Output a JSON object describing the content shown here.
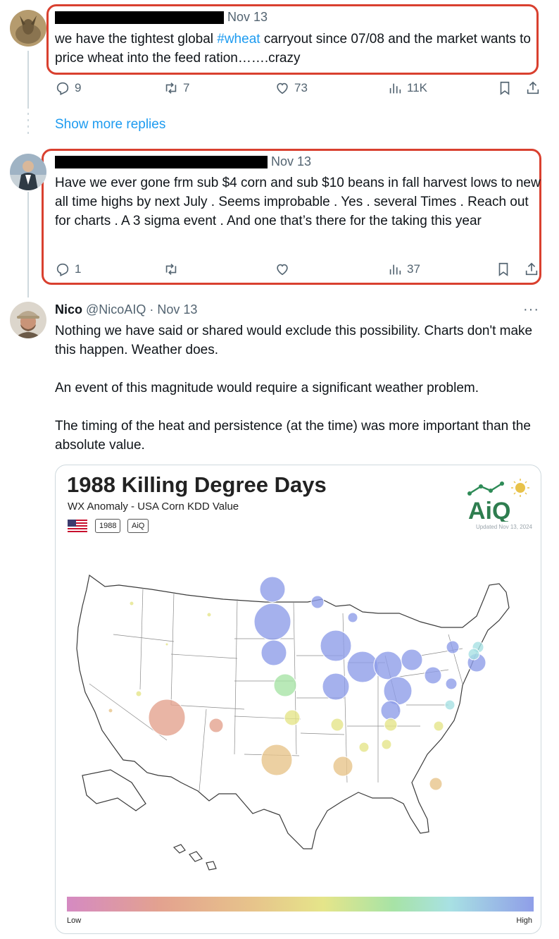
{
  "tweets": [
    {
      "name": "",
      "handle": "",
      "date": "Nov 13",
      "text": "we have the tightest global #wheat carryout since 07/08 and the market wants to price wheat into the feed ration…….crazy",
      "text_before": "we have the tightest global ",
      "hashtag": "#wheat",
      "text_after": " carryout since 07/08 and the market wants to price wheat into the feed ration…….crazy",
      "replies": "9",
      "retweets": "7",
      "likes": "73",
      "views": "11K"
    },
    {
      "name": "",
      "handle": "",
      "date": "Nov 13",
      "text": "Have we ever gone frm sub $4 corn and sub $10 beans in fall harvest lows to new all time highs by next July . Seems improbable . Yes . several Times . Reach out for charts . A 3 sigma event . And one that’s there for the taking  this year",
      "replies": "1",
      "retweets": "",
      "likes": "",
      "views": "37"
    },
    {
      "name": "Nico",
      "handle": "@NicoAIQ",
      "separator": "·",
      "date": "Nov 13",
      "paragraphs": [
        "Nothing we have said or shared would exclude this possibility. Charts don't make this happen. Weather does.",
        "An event of this magnitude would require a significant weather problem.",
        "The timing of the heat and persistence (at the time) was more important than the absolute value."
      ]
    }
  ],
  "show_more_replies": "Show more replies",
  "more_icon": "···",
  "card": {
    "title": "1988 Killing Degree Days",
    "subtitle": "WX Anomaly - USA Corn KDD Value",
    "tags": [
      "1988",
      "AiQ"
    ],
    "logo_text": "AiQ",
    "updated": "Updated Nov 13, 2024",
    "legend_low": "Low",
    "legend_high": "High",
    "colors": [
      "#d58ac2",
      "#e3a28f",
      "#e7c48b",
      "#e5e58a",
      "#a7e3a6",
      "#a8e1e3",
      "#8f9ee8"
    ]
  },
  "colors": {
    "link": "#1d9bf0",
    "highlight_box": "#d9402f",
    "muted": "#536471"
  },
  "icons": [
    "reply-icon",
    "retweet-icon",
    "like-icon",
    "views-icon",
    "bookmark-icon",
    "share-icon",
    "more-icon"
  ]
}
